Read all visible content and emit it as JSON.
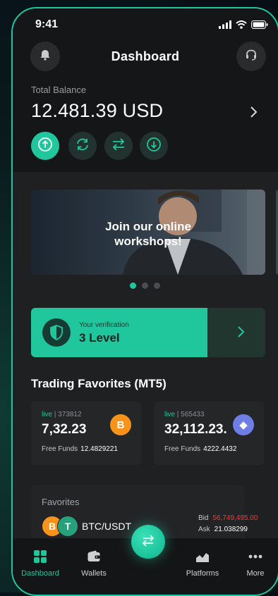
{
  "status_bar": {
    "time": "9:41"
  },
  "header": {
    "title": "Dashboard",
    "left_icon": "bell-icon",
    "right_icon": "headset-icon"
  },
  "balance": {
    "label": "Total Balance",
    "value": "12.481.39 USD"
  },
  "actions": [
    "deposit-arrow-up-icon",
    "refresh-icon",
    "transfer-icon",
    "withdraw-arrow-down-icon"
  ],
  "banner": {
    "line1": "Join our online",
    "line2": "workshops!",
    "pages": 3,
    "active_page": 1
  },
  "verification": {
    "label": "Your verification",
    "level": "3 Level"
  },
  "trading_favorites": {
    "title": "Trading Favorites (MT5)",
    "cards": [
      {
        "live": "live",
        "account": "373812",
        "price": "7,32.23",
        "coin": "B",
        "funds_label": "Free Funds",
        "funds_value": "12.4829221"
      },
      {
        "live": "live",
        "account": "565433",
        "price": "32,112.23.",
        "coin": "◆",
        "funds_label": "Free Funds",
        "funds_value": "4222.4432"
      }
    ]
  },
  "favorites": {
    "title": "Favorites",
    "pair": "BTC/USDT",
    "coin1": "B",
    "coin2": "T",
    "bid_label": "Bid",
    "bid_value": "56,749,495.00",
    "ask_label": "Ask",
    "ask_value": "21.038299"
  },
  "nav": {
    "items": [
      {
        "label": "Dashboard",
        "active": true
      },
      {
        "label": "Wallets",
        "active": false
      },
      {
        "label": "Platforms",
        "active": false
      },
      {
        "label": "More",
        "active": false
      }
    ]
  },
  "colors": {
    "accent": "#20c79d",
    "background": "#1f2022",
    "bid_red": "#e0413c",
    "btc_orange": "#f7931a",
    "eth_purple": "#6f7de6"
  }
}
